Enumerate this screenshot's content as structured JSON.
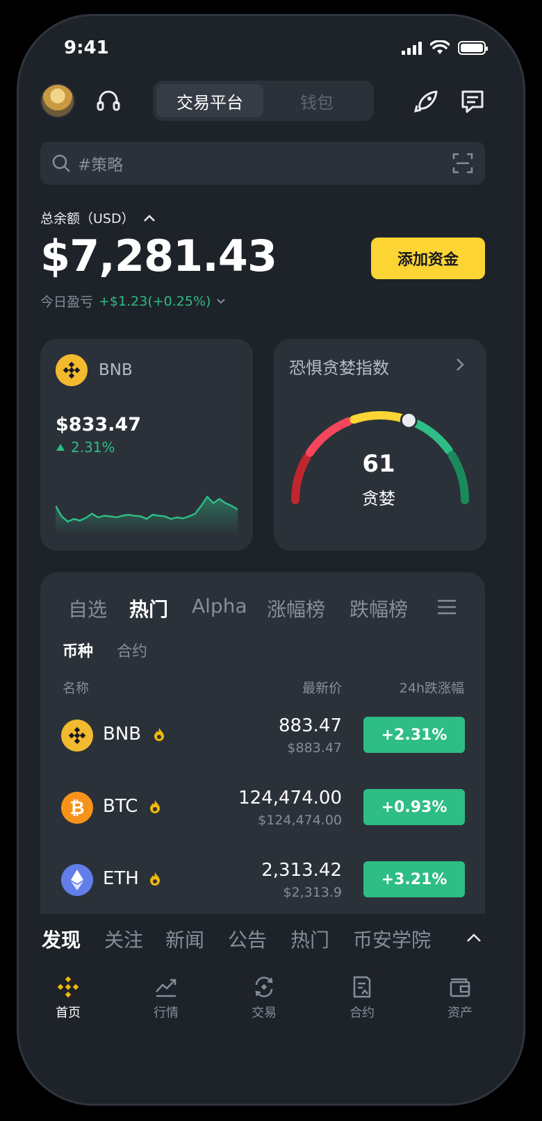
{
  "status": {
    "time": "9:41"
  },
  "header": {
    "tabs": [
      "交易平台",
      "钱包"
    ]
  },
  "search": {
    "placeholder": "#策略"
  },
  "balance": {
    "label": "总余额（USD）",
    "amount": "$7,281.43",
    "add_funds": "添加资金",
    "pnl_label": "今日盈亏",
    "pnl_value": "+$1.23(+0.25%)"
  },
  "bnb_card": {
    "symbol": "BNB",
    "price": "$833.47",
    "change": "2.31%",
    "sparkline": [
      0.55,
      0.35,
      0.25,
      0.3,
      0.27,
      0.32,
      0.4,
      0.33,
      0.36,
      0.35,
      0.33,
      0.36,
      0.38,
      0.36,
      0.35,
      0.3,
      0.38,
      0.36,
      0.35,
      0.3,
      0.33,
      0.31,
      0.35,
      0.4,
      0.55,
      0.72,
      0.6,
      0.68,
      0.6,
      0.55,
      0.48
    ]
  },
  "fear_greed": {
    "title": "恐惧贪婪指数",
    "value": "61",
    "label": "贪婪",
    "level": 0.61
  },
  "markets": {
    "tabs": [
      "自选",
      "热门",
      "Alpha",
      "涨幅榜",
      "跌幅榜"
    ],
    "subtabs": [
      "币种",
      "合约"
    ],
    "columns": [
      "名称",
      "最新价",
      "24h跌涨幅"
    ],
    "rows": [
      {
        "symbol": "BNB",
        "price": "883.47",
        "usd": "$883.47",
        "change": "+2.31%",
        "color": "#f3ba2f"
      },
      {
        "symbol": "BTC",
        "price": "124,474.00",
        "usd": "$124,474.00",
        "change": "+0.93%",
        "color": "#f7931a"
      },
      {
        "symbol": "ETH",
        "price": "2,313.42",
        "usd": "$2,313.9",
        "change": "+3.21%",
        "color": "#627eea"
      }
    ]
  },
  "discover": {
    "tabs": [
      "发现",
      "关注",
      "新闻",
      "公告",
      "热门",
      "币安学院"
    ]
  },
  "nav": {
    "items": [
      "首页",
      "行情",
      "交易",
      "合约",
      "资产"
    ]
  },
  "colors": {
    "accent": "#fcd535",
    "up": "#2ebd85",
    "bg": "#1e2329"
  }
}
